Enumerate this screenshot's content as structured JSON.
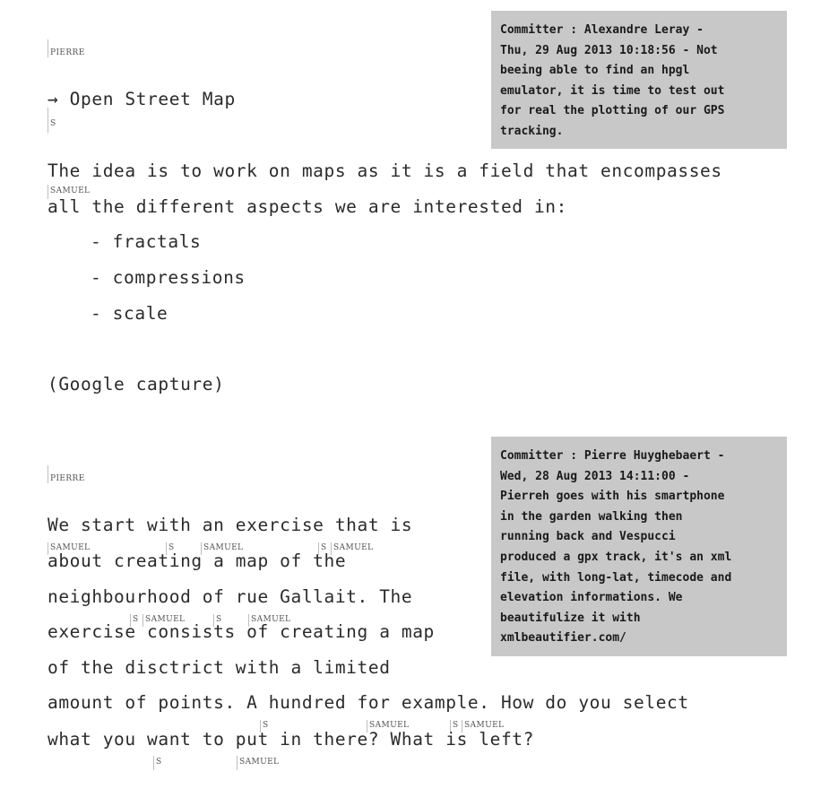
{
  "section1": {
    "author_tag": "PIERRE",
    "link_text": "→ Open Street Map",
    "link_tag": "S",
    "note_lines": [
      "Committer : Alexandre Leray -",
      "Thu, 29 Aug 2013 10:18:56 - Not",
      "beeing able to find an hpgl",
      "emulator, it is time to test out",
      "for real the plotting of our GPS",
      "tracking."
    ],
    "para_line1": "The idea is to work on maps as it is a field that encompasses",
    "para_tag": "SAMUEL",
    "para_line2": "all the different aspects we are interested in:",
    "list": [
      "- fractals",
      "- compressions",
      "- scale"
    ],
    "caption": "(Google capture)"
  },
  "section2": {
    "author_tag": "PIERRE",
    "note_lines": [
      "Committer : Pierre Huyghebaert -",
      "Wed, 28 Aug 2013 14:11:00 -",
      "Pierreh goes with his smartphone",
      "in the garden walking then",
      "running back and Vespucci",
      "produced a gpx track, it's an xml",
      "file, with long-lat, timecode and",
      "elevation informations. We",
      "beautifulize it with",
      "xmlbeautifier.com/"
    ],
    "lines": [
      "We start with an exercise that is",
      "about creating a map of the",
      "neighbourhood of rue Gallait. The",
      "exercise consists of creating a map",
      "of the disctrict with a limited",
      "amount of points. A hundred for example. How do you select",
      "what you want to put in there? What is left?"
    ],
    "tags": {
      "row1": [
        "SAMUEL",
        "S",
        "SAMUEL",
        "S",
        "SAMUEL"
      ],
      "row2": [
        "S",
        "SAMUEL",
        "S",
        "SAMUEL"
      ],
      "row3": [
        "S",
        "SAMUEL",
        "S",
        "SAMUEL"
      ],
      "row4": [
        "S",
        "SAMUEL"
      ]
    }
  }
}
